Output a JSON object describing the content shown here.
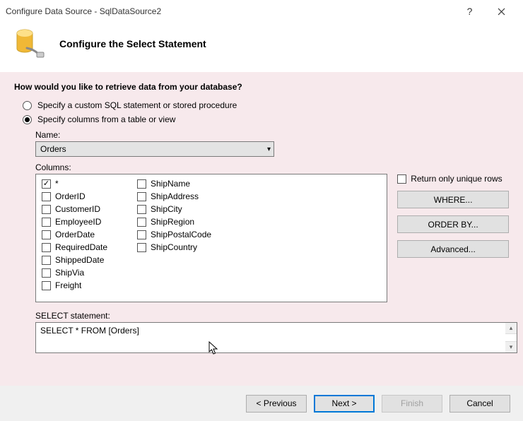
{
  "title": "Configure Data Source - SqlDataSource2",
  "header": {
    "title": "Configure the Select Statement"
  },
  "question": "How would you like to retrieve data from your database?",
  "radios": {
    "custom": "Specify a custom SQL statement or stored procedure",
    "columns": "Specify columns from a table or view"
  },
  "name_label": "Name:",
  "name_value": "Orders",
  "columns_label": "Columns:",
  "columns": {
    "col1": [
      "*",
      "OrderID",
      "CustomerID",
      "EmployeeID",
      "OrderDate",
      "RequiredDate",
      "ShippedDate",
      "ShipVia",
      "Freight"
    ],
    "col2": [
      "ShipName",
      "ShipAddress",
      "ShipCity",
      "ShipRegion",
      "ShipPostalCode",
      "ShipCountry"
    ]
  },
  "checked_columns": [
    "*"
  ],
  "side": {
    "unique": "Return only unique rows",
    "where": "WHERE...",
    "orderby": "ORDER BY...",
    "advanced": "Advanced..."
  },
  "stmt_label": "SELECT statement:",
  "stmt_value": "SELECT * FROM [Orders]",
  "footer": {
    "prev": "< Previous",
    "next": "Next >",
    "finish": "Finish",
    "cancel": "Cancel"
  }
}
